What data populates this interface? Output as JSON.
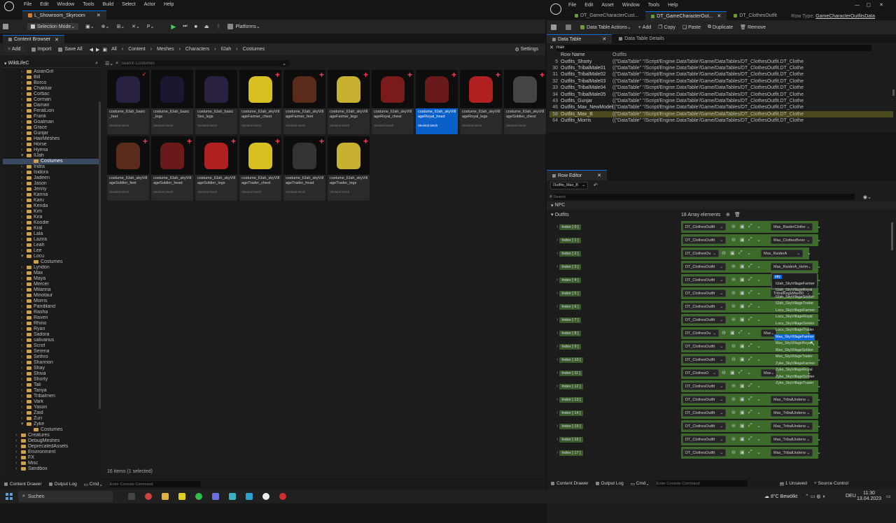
{
  "left_window": {
    "level_tab": "L_Showroom_Skyroom",
    "menu": [
      "File",
      "Edit",
      "Window",
      "Tools",
      "Build",
      "Select",
      "Actor",
      "Help"
    ],
    "toolbar": {
      "selection_mode": "Selection Mode",
      "platforms": "Platforms"
    },
    "content_browser": {
      "tab": "Content Browser",
      "add": "Add",
      "import": "Import",
      "save_all": "Save All",
      "breadcrumb": [
        "All",
        "Content",
        "Meshes",
        "Characters",
        "IlJah",
        "Costumes"
      ],
      "settings": "Settings",
      "search_placeholder": "Search Costumes",
      "root": "WildLifeC",
      "tree": [
        "AsianGirl",
        "Bill",
        "Borco",
        "Chakkar",
        "Corbac",
        "Corman",
        "Damari",
        "FeralLion",
        "Frank",
        "Goatman",
        "Grace",
        "Gunjar",
        "HairMeshes",
        "Horse",
        "Hyena",
        "IlJah",
        "Costumes",
        "Indra",
        "Isidora",
        "Jadeen",
        "Jason",
        "Jenny",
        "Karina",
        "Karu",
        "Kenda",
        "Kim",
        "Kira",
        "Koodie",
        "Kral",
        "Lala",
        "Lazira",
        "Leah",
        "Lee",
        "Locu",
        "Costumes",
        "Lyndon",
        "Max",
        "Maya",
        "Mercer",
        "Milanna",
        "Minotaur",
        "Morris",
        "Pandiland",
        "Rasha",
        "Raven",
        "Rhino",
        "Ryan",
        "Sadora",
        "salivarius",
        "Scrof",
        "Serena",
        "Sethro",
        "Shannon",
        "Shay",
        "Shiva",
        "Shorty",
        "Tali",
        "Tanya",
        "Tribalmen",
        "Vark",
        "Yason",
        "Zaid",
        "Zuri",
        "Zyke",
        "Costumes",
        "Creatures",
        "DebugMeshes",
        "DeprecatedAssets",
        "Environment",
        "FX",
        "Misc",
        "Sandbox"
      ],
      "assets": [
        {
          "label": "costume_IlJah_basic_feet",
          "type": "Skeletal Mesh",
          "marker": "check"
        },
        {
          "label": "costume_IlJah_basic_legs",
          "type": "Skeletal Mesh",
          "marker": "none"
        },
        {
          "label": "costume_IlJah_basicSex_legs",
          "type": "Skeletal Mesh",
          "marker": "none"
        },
        {
          "label": "costume_IlJah_skyVillageFarmer_chest",
          "type": "Skeletal Mesh",
          "marker": "plus"
        },
        {
          "label": "costume_IlJah_skyVillageFarmer_feet",
          "type": "Skeletal Mesh",
          "marker": "plus"
        },
        {
          "label": "costume_IlJah_skyVillageFarmer_legs",
          "type": "Skeletal Mesh",
          "marker": "plus"
        },
        {
          "label": "costume_IlJah_skyVillageRoyal_chest",
          "type": "Skeletal Mesh",
          "marker": "plus"
        },
        {
          "label": "costume_IlJah_skyVillageRoyal_head",
          "type": "Skeletal Mesh",
          "marker": "plus"
        },
        {
          "label": "costume_IlJah_skyVillageRoyal_legs",
          "type": "Skeletal Mesh",
          "marker": "plus"
        },
        {
          "label": "costume_IlJah_skyVillageSoldier_chest",
          "type": "Skeletal Mesh",
          "marker": "plus"
        },
        {
          "label": "costume_IlJah_skyVillageSoldier_feet",
          "type": "Skeletal Mesh",
          "marker": "plus"
        },
        {
          "label": "costume_IlJah_skyVillageSoldier_head",
          "type": "Skeletal Mesh",
          "marker": "plus"
        },
        {
          "label": "costume_IlJah_skyVillageSoldier_legs",
          "type": "Skeletal Mesh",
          "marker": "plus"
        },
        {
          "label": "costume_IlJah_skyVillageTrader_chest",
          "type": "Skeletal Mesh",
          "marker": "plus"
        },
        {
          "label": "costume_IlJah_skyVillageTrader_head",
          "type": "Skeletal Mesh",
          "marker": "plus"
        },
        {
          "label": "costume_IlJah_skyVillageTrader_legs",
          "type": "Skeletal Mesh",
          "marker": "plus"
        }
      ],
      "status": "16 items (1 selected)"
    },
    "bottom": {
      "drawer": "Content Drawer",
      "output": "Output Log",
      "cmd": "Cmd",
      "console_placeholder": "Enter Console Command"
    }
  },
  "right_window": {
    "menu": [
      "File",
      "Edit",
      "Asset",
      "Window",
      "Tools",
      "Help"
    ],
    "tabs": [
      "DT_GameCharacterCust...",
      "DT_GameCharacterOut...",
      "DT_ClothesOutfit"
    ],
    "row_type_label": "Row Type:",
    "row_type": "GameCharacterOutfitsData",
    "toolbar": {
      "actions": "Data Table Actions",
      "add": "Add",
      "copy": "Copy",
      "paste": "Paste",
      "duplicate": "Duplicate",
      "remove": "Remove"
    },
    "panels": {
      "data_table": "Data Table",
      "details": "Data Table Details"
    },
    "filter": "max",
    "columns": {
      "row_name": "Row Name",
      "outfits": "Outfits"
    },
    "rows": [
      {
        "n": "5",
        "name": "Outfits_Shorty",
        "val": "((\"DataTable\" \"/Script/Engine.DataTable'/Game/DataTables/DT_ClothesOutfit.DT_Clothe"
      },
      {
        "n": "30",
        "name": "Outfits_TribalMale01",
        "val": "((\"DataTable\" \"/Script/Engine.DataTable'/Game/DataTables/DT_ClothesOutfit.DT_Clothe"
      },
      {
        "n": "31",
        "name": "Outfits_TribalMale02",
        "val": "((\"DataTable\" \"/Script/Engine.DataTable'/Game/DataTables/DT_ClothesOutfit.DT_Clothe"
      },
      {
        "n": "32",
        "name": "Outfits_TribalMale03",
        "val": "((\"DataTable\" \"/Script/Engine.DataTable'/Game/DataTables/DT_ClothesOutfit.DT_Clothe"
      },
      {
        "n": "33",
        "name": "Outfits_TribalMale04",
        "val": "((\"DataTable\" \"/Script/Engine.DataTable'/Game/DataTables/DT_ClothesOutfit.DT_Clothe"
      },
      {
        "n": "34",
        "name": "Outfits_TribalMale05",
        "val": "((\"DataTable\" \"/Script/Engine.DataTable'/Game/DataTables/DT_ClothesOutfit.DT_Clothe"
      },
      {
        "n": "43",
        "name": "Outfits_Gunjar",
        "val": "((\"DataTable\" \"/Script/Engine.DataTable'/Game/DataTables/DT_ClothesOutfit.DT_Clothe"
      },
      {
        "n": "46",
        "name": "Outfits_Max_NewModel",
        "val": "((\"DataTable\" \"/Script/Engine.DataTable'/Game/DataTables/DT_ClothesOutfit.DT_Clothe"
      },
      {
        "n": "58",
        "name": "Outfits_Max_B",
        "val": "((\"DataTable\" \"/Script/Engine.DataTable'/Game/DataTables/DT_ClothesOutfit.DT_Clothe"
      },
      {
        "n": "64",
        "name": "Outfits_Morris",
        "val": "((\"DataTable\" \"/Script/Engine.DataTable'/Game/DataTables/DT_ClothesOutfit.DT_Clothe"
      }
    ],
    "row_editor": {
      "tab": "Row Editor",
      "row": "Outfits_Max_B",
      "search_placeholder": "Search",
      "category": "NPC",
      "field": "Outfits",
      "count": "18 Array elements"
    },
    "indices": [
      {
        "label": "Index [ 0 ]",
        "dt": "DT_ClothesOutfit",
        "val": "Max_RaiderClothe"
      },
      {
        "label": "Index [ 1 ]",
        "dt": "DT_ClothesOutfit",
        "val": "Max_ClothesBoon"
      },
      {
        "label": "Index [ 2 ]",
        "dt": "DT_ClothesOu",
        "val": "Max_RaiderA"
      },
      {
        "label": "Index [ 3 ]",
        "dt": "DT_ClothesOutfit",
        "val": "Max_RaiderA_Helm"
      },
      {
        "label": "Index [ 4 ]",
        "dt": "DT_ClothesOutfit",
        "val": "TribalRagsMax40"
      },
      {
        "label": "Index [ 5 ]",
        "dt": "DT_ClothesOutfit",
        "val": "TribalRagsMax80"
      },
      {
        "label": "Index [ 6 ]",
        "dt": "DT_ClothesOutfit",
        "val": ""
      },
      {
        "label": "Index [ 7 ]",
        "dt": "DT_ClothesOutfit",
        "val": ""
      },
      {
        "label": "Index [ 8 ]",
        "dt": "DT_ClothesOu",
        "val": "Max"
      },
      {
        "label": "Index [ 9 ]",
        "dt": "DT_ClothesOutfit",
        "val": ""
      },
      {
        "label": "Index [ 10 ]",
        "dt": "DT_ClothesOutfit",
        "val": ""
      },
      {
        "label": "Index [ 11 ]",
        "dt": "DT_ClothesO",
        "val": "Max"
      },
      {
        "label": "Index [ 12 ]",
        "dt": "DT_ClothesOutfit",
        "val": ""
      },
      {
        "label": "Index [ 13 ]",
        "dt": "DT_ClothesOutfit",
        "val": "Max_TribalUnderw"
      },
      {
        "label": "Index [ 14 ]",
        "dt": "DT_ClothesOutfit",
        "val": "Max_TribalUnderw"
      },
      {
        "label": "Index [ 15 ]",
        "dt": "DT_ClothesOutfit",
        "val": "Max_TribalUnderw"
      },
      {
        "label": "Index [ 16 ]",
        "dt": "DT_ClothesOutfit",
        "val": "Max_TribalUnderw"
      },
      {
        "label": "Index [ 17 ]",
        "dt": "DT_ClothesOutfit",
        "val": "Max_TribalUnderw"
      }
    ],
    "dropdown": {
      "search": "sky",
      "options": [
        "IlJah_SkyVillageFarmer",
        "IlJah_SkyVillageRoyal",
        "IlJah_SkyVillageSoldier",
        "IlJah_SkyVillageTrader",
        "Locu_SkyVillageFarmer",
        "Locu_SkyVillageRoyal",
        "Locu_SkyVillageSoldier",
        "Locu_SkyVillageTrader",
        "Max_SkyVillageFarmer",
        "Max_SkyVillageRoyal",
        "Max_SkyVillageSoldier",
        "Max_SkyVillageTrader",
        "Zyke_SkyVillageFarmer",
        "Zyke_SkyVillageRoyal",
        "Zyke_SkyVillageSoldier",
        "Zyke_SkyVillageTrader"
      ],
      "highlighted": 8
    },
    "bottom": {
      "drawer": "Content Drawer",
      "output": "Output Log",
      "cmd": "Cmd",
      "console_placeholder": "Enter Console Command",
      "unsaved": "1 Unsaved",
      "source": "Source Control"
    }
  },
  "taskbar": {
    "search": "Suchen",
    "weather": "8°C Bewölkt",
    "lang": "DEU",
    "time": "11:30",
    "date": "13.04.2023"
  }
}
